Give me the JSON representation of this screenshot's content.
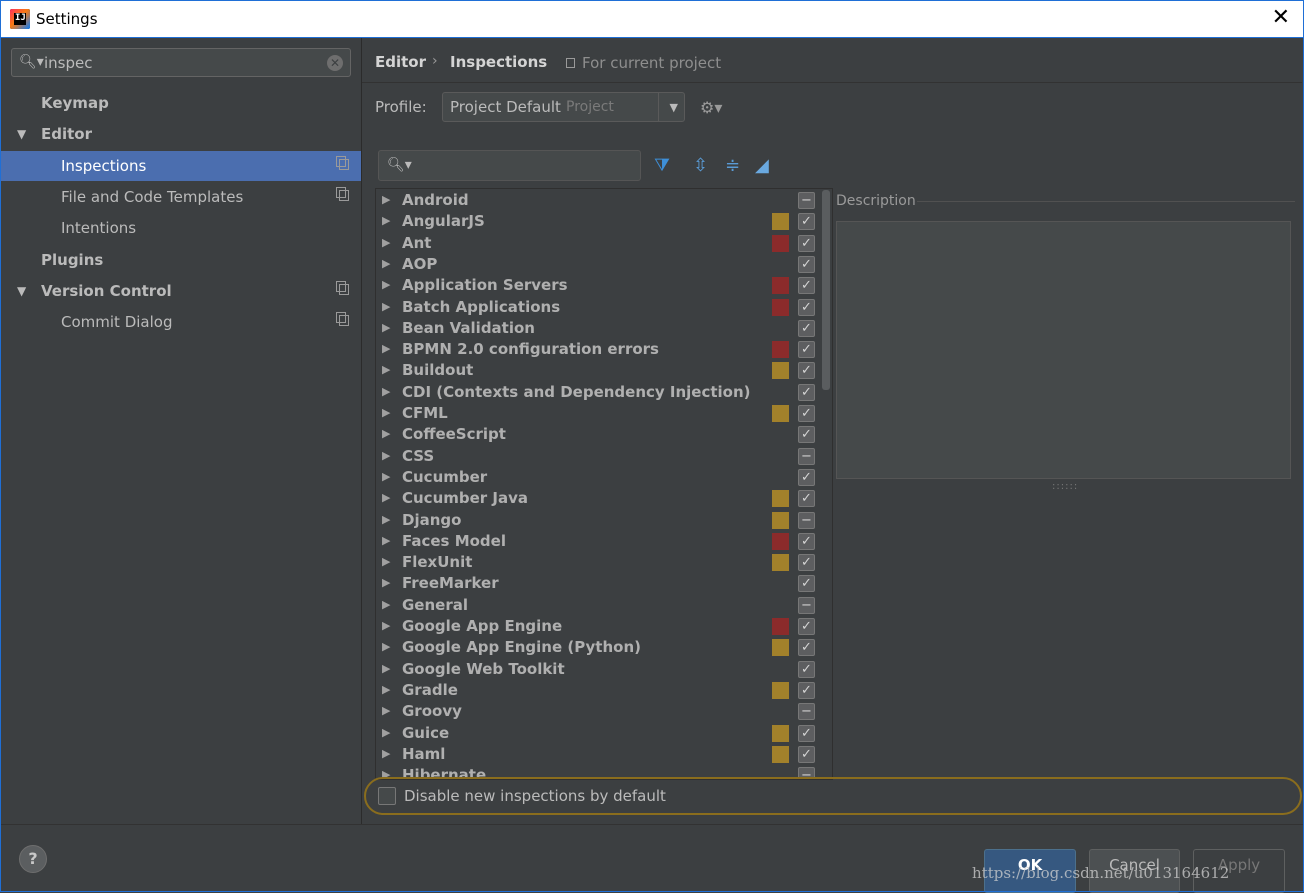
{
  "window": {
    "title": "Settings",
    "close_glyph": "✕"
  },
  "search": {
    "value": "inspec",
    "clear_glyph": "✕"
  },
  "sidebar": {
    "items": [
      {
        "label": "Keymap",
        "bold": true,
        "arrow": "",
        "copy": false
      },
      {
        "label": "Editor",
        "bold": true,
        "arrow": "▼",
        "copy": false
      },
      {
        "label": "Inspections",
        "bold": false,
        "arrow": "",
        "copy": true,
        "selected": true
      },
      {
        "label": "File and Code Templates",
        "bold": false,
        "arrow": "",
        "copy": true
      },
      {
        "label": "Intentions",
        "bold": false,
        "arrow": "",
        "copy": false
      },
      {
        "label": "Plugins",
        "bold": true,
        "arrow": "",
        "copy": false
      },
      {
        "label": "Version Control",
        "bold": true,
        "arrow": "▼",
        "copy": true
      },
      {
        "label": "Commit Dialog",
        "bold": false,
        "arrow": "",
        "copy": true
      }
    ]
  },
  "breadcrumb": {
    "editor": "Editor",
    "separator": "›",
    "inspections": "Inspections",
    "project_scope": "For current project"
  },
  "profile": {
    "label": "Profile:",
    "name": "Project Default",
    "type": "Project",
    "dropdown_glyph": "▼",
    "gear_glyph": "⚙▾"
  },
  "toolbar": {
    "search_glyph": "🔍︎▾",
    "filter_glyph": "⧩",
    "expand_glyph": "⇳",
    "collapse_glyph": "≑",
    "reset_glyph": "◢"
  },
  "colors": {
    "warning": "#a2812b",
    "error": "#8b2b2b",
    "selected": "#4b6eaf",
    "accent_ok": "#365880"
  },
  "inspections": [
    {
      "label": "Android",
      "severity": "",
      "state": "partial"
    },
    {
      "label": "AngularJS",
      "severity": "warning",
      "state": "checked"
    },
    {
      "label": "Ant",
      "severity": "error",
      "state": "checked"
    },
    {
      "label": "AOP",
      "severity": "",
      "state": "checked"
    },
    {
      "label": "Application Servers",
      "severity": "error",
      "state": "checked"
    },
    {
      "label": "Batch Applications",
      "severity": "error",
      "state": "checked"
    },
    {
      "label": "Bean Validation",
      "severity": "",
      "state": "checked"
    },
    {
      "label": "BPMN 2.0 configuration errors",
      "severity": "error",
      "state": "checked"
    },
    {
      "label": "Buildout",
      "severity": "warning",
      "state": "checked"
    },
    {
      "label": "CDI (Contexts and Dependency Injection)",
      "severity": "",
      "state": "checked"
    },
    {
      "label": "CFML",
      "severity": "warning",
      "state": "checked"
    },
    {
      "label": "CoffeeScript",
      "severity": "",
      "state": "checked"
    },
    {
      "label": "CSS",
      "severity": "",
      "state": "partial"
    },
    {
      "label": "Cucumber",
      "severity": "",
      "state": "checked"
    },
    {
      "label": "Cucumber Java",
      "severity": "warning",
      "state": "checked"
    },
    {
      "label": "Django",
      "severity": "warning",
      "state": "partial"
    },
    {
      "label": "Faces Model",
      "severity": "error",
      "state": "checked"
    },
    {
      "label": "FlexUnit",
      "severity": "warning",
      "state": "checked"
    },
    {
      "label": "FreeMarker",
      "severity": "",
      "state": "checked"
    },
    {
      "label": "General",
      "severity": "",
      "state": "partial"
    },
    {
      "label": "Google App Engine",
      "severity": "error",
      "state": "checked"
    },
    {
      "label": "Google App Engine (Python)",
      "severity": "warning",
      "state": "checked"
    },
    {
      "label": "Google Web Toolkit",
      "severity": "",
      "state": "checked"
    },
    {
      "label": "Gradle",
      "severity": "warning",
      "state": "checked"
    },
    {
      "label": "Groovy",
      "severity": "",
      "state": "partial"
    },
    {
      "label": "Guice",
      "severity": "warning",
      "state": "checked"
    },
    {
      "label": "Haml",
      "severity": "warning",
      "state": "checked"
    },
    {
      "label": "Hibernate",
      "severity": "",
      "state": "partial"
    }
  ],
  "description": {
    "label": "Description",
    "splitter": "::::::"
  },
  "disable_new": {
    "label": "Disable new inspections by default"
  },
  "footer": {
    "help": "?",
    "ok": "OK",
    "cancel": "Cancel",
    "apply": "Apply"
  },
  "watermark": "https://blog.csdn.net/u013164612"
}
